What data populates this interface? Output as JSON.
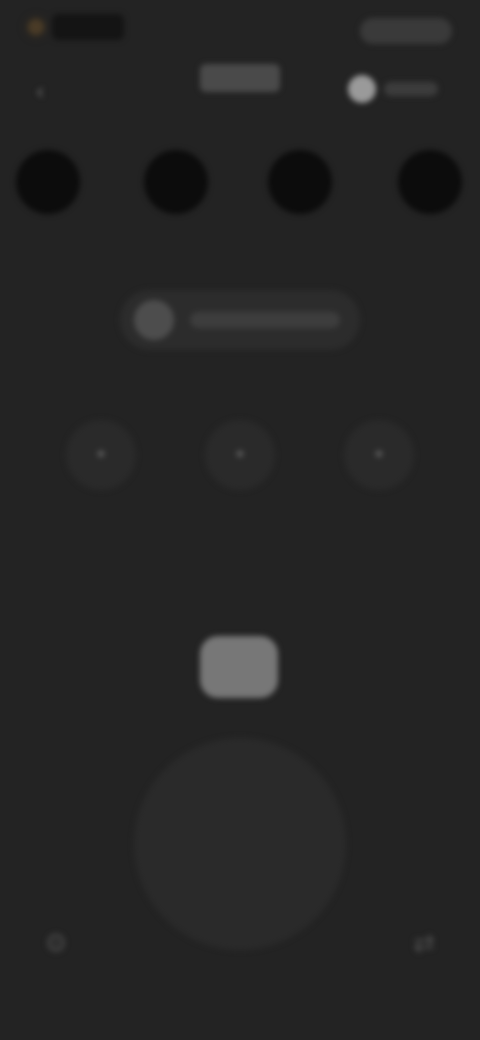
{
  "topbar": {
    "record_label": "",
    "right_label": "",
    "title": ""
  },
  "icons": {
    "back": "arrow-left-icon",
    "toggle": "toggle-icon",
    "search": "search-icon",
    "mid_left": "tool-icon",
    "mid_center": "tool-icon",
    "mid_right": "tool-icon",
    "bottom_left": "gear-icon",
    "bottom_right": "swap-icon"
  },
  "colors": {
    "background": "#232323",
    "dark_circle": "#0c0c0c",
    "panel": "#2c2c2c",
    "highlight": "#777777"
  }
}
